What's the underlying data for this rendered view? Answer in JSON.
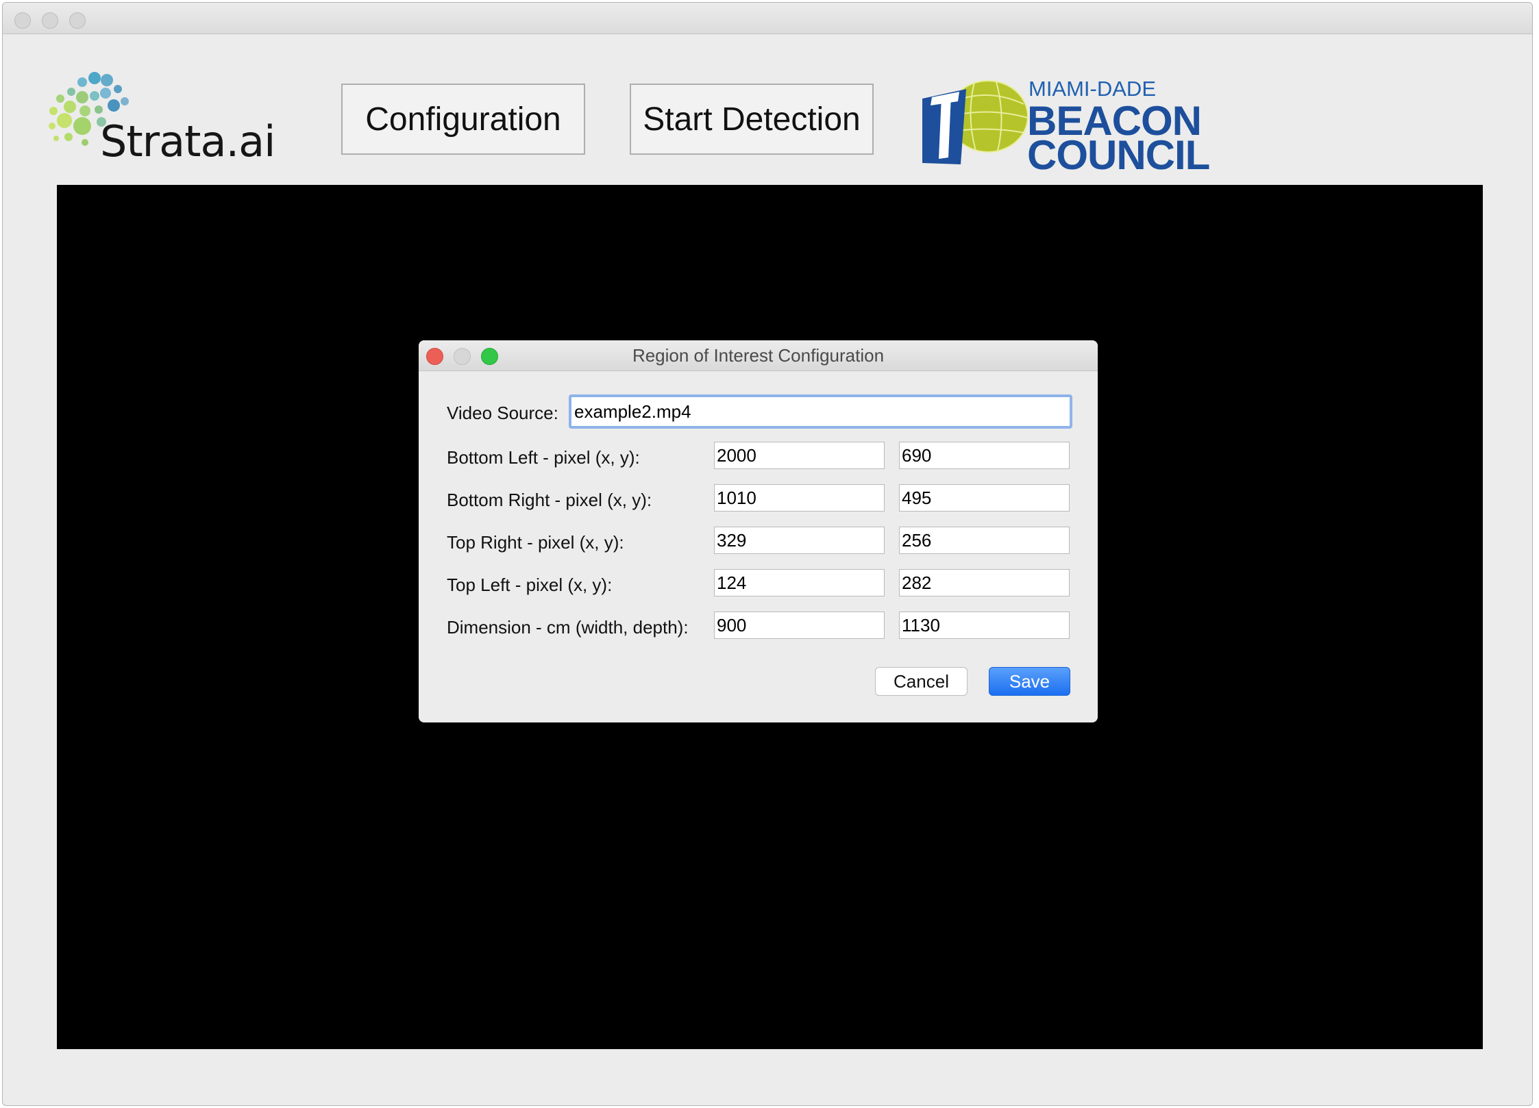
{
  "app": {
    "logo_text": "Strata.ai",
    "configuration_button": "Configuration",
    "start_detection_button": "Start Detection",
    "partner_logo": {
      "line1": "MIAMI-DADE",
      "line2": "BEACON",
      "line3": "COUNCIL"
    }
  },
  "dialog": {
    "title": "Region of Interest Configuration",
    "video_source_label": "Video Source:",
    "video_source_value": "example2.mp4",
    "rows": [
      {
        "label": "Bottom Left - pixel (x, y):",
        "a": "2000",
        "b": "690"
      },
      {
        "label": "Bottom Right - pixel (x, y):",
        "a": "1010",
        "b": "495"
      },
      {
        "label": "Top Right - pixel (x, y):",
        "a": "329",
        "b": "256"
      },
      {
        "label": "Top Left - pixel (x, y):",
        "a": "124",
        "b": "282"
      },
      {
        "label": "Dimension - cm (width, depth):",
        "a": "900",
        "b": "1130"
      }
    ],
    "cancel_label": "Cancel",
    "save_label": "Save"
  },
  "colors": {
    "accent": "#1c6ff0",
    "brand_blue": "#1d4f9c",
    "brand_green": "#b5c42a",
    "close": "#ec5f57",
    "zoom": "#33c748"
  }
}
